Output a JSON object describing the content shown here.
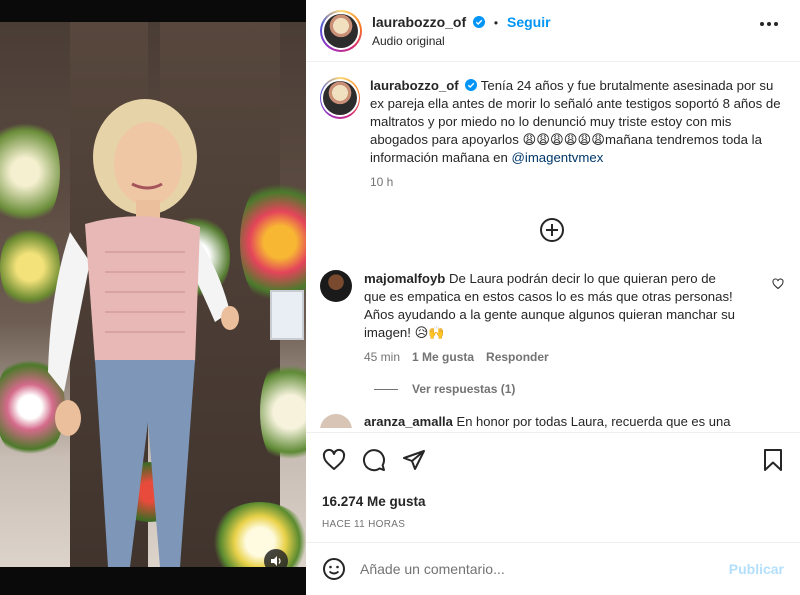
{
  "post": {
    "author": "laurabozzo_of",
    "follow_label": "Seguir",
    "audio_label": "Audio original",
    "more_icon": "more-options-icon",
    "verified_color": "#0095f6"
  },
  "caption": {
    "author": "laurabozzo_of",
    "text_main": "Tenía 24 años y fue brutalmente asesinada por su ex pareja ella antes de morir lo señaló ante testigos soportó 8 años de maltratos y por miedo no lo denunció muy triste estoy con mis abogados para apoyarlos",
    "emojis": "😩😩😩😩😩😩",
    "text_end": "mañana tendremos toda la información mañana en",
    "mention": "@imagentvmex",
    "time": "10 h"
  },
  "comments": [
    {
      "author": "majomalfoyb",
      "text": "De Laura podrán decir lo que quieran pero de que es empatica en estos casos lo es más que otras personas! Años ayudando a la gente aunque algunos quieran manchar su imagen!",
      "emojis": "😥🙌",
      "time": "45 min",
      "likes_label": "1 Me gusta",
      "reply_label": "Responder",
      "view_replies": "Ver respuestas (1)"
    }
  ],
  "peek_comment": {
    "author": "aranza_amalla",
    "text": "En honor por todas Laura, recuerda que es una"
  },
  "actions": {
    "like_icon": "heart-icon",
    "comment_icon": "comment-icon",
    "share_icon": "share-icon",
    "save_icon": "bookmark-icon",
    "likes_text": "16.274 Me gusta",
    "posted_time": "HACE 11 HORAS"
  },
  "composer": {
    "placeholder": "Añade un comentario...",
    "publish_label": "Publicar",
    "emoji_icon": "emoji-icon"
  },
  "colors": {
    "accent": "#0095f6",
    "link": "#00376b",
    "muted": "#737373",
    "publish_disabled": "#b2dffc"
  }
}
